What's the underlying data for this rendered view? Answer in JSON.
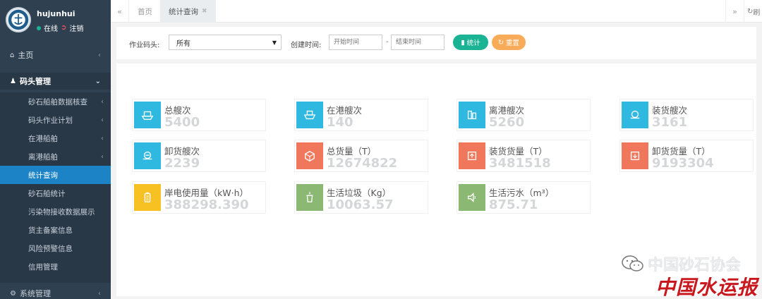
{
  "sidebar": {
    "username": "hujunhui",
    "status_online": "在线",
    "logout": "注销",
    "home": "主页",
    "dock_mgmt": "码头管理",
    "sub_items": [
      {
        "label": "砂石船舶数据核查",
        "chevron": true
      },
      {
        "label": "码头作业计划",
        "chevron": true
      },
      {
        "label": "在港船舶",
        "chevron": true
      },
      {
        "label": "离港船舶",
        "chevron": true
      },
      {
        "label": "统计查询",
        "chevron": false,
        "active": true
      },
      {
        "label": "砂石船统计",
        "chevron": false
      },
      {
        "label": "污染物接收数据展示",
        "chevron": false
      },
      {
        "label": "货主备案信息",
        "chevron": false
      },
      {
        "label": "风险预警信息",
        "chevron": false
      },
      {
        "label": "信用管理",
        "chevron": false
      }
    ],
    "system_mgmt": "系统管理"
  },
  "tabs": {
    "home": "首页",
    "stats_query": "统计查询",
    "refresh": "刷"
  },
  "filter": {
    "dock_label": "作业码头:",
    "dock_value": "所有",
    "created_label": "创建时间:",
    "start_placeholder": "开始时间",
    "end_placeholder": "结束时间",
    "separator": "-",
    "stat_button": "统计",
    "reset_button": "重置"
  },
  "cards": [
    {
      "label": "总艘次",
      "value": "5400",
      "color": "#2fb8e0",
      "icon": "ship-icon"
    },
    {
      "label": "在港艘次",
      "value": "140",
      "color": "#2fb8e0",
      "icon": "ship-in-port-icon"
    },
    {
      "label": "离港艘次",
      "value": "5260",
      "color": "#2fb8e0",
      "icon": "ship-departed-icon"
    },
    {
      "label": "装货艘次",
      "value": "3161",
      "color": "#2fb8e0",
      "icon": "loading-ship-icon"
    },
    {
      "label": "卸货艘次",
      "value": "2239",
      "color": "#2fb8e0",
      "icon": "unloading-ship-icon"
    },
    {
      "label": "总货量（T）",
      "value": "12674822",
      "color": "#f0775c",
      "icon": "cargo-box-icon"
    },
    {
      "label": "装货货量（T）",
      "value": "3481518",
      "color": "#f0775c",
      "icon": "load-cargo-icon"
    },
    {
      "label": "卸货货量（T）",
      "value": "9193304",
      "color": "#f0775c",
      "icon": "unload-cargo-icon"
    },
    {
      "label": "岸电使用量（kW·h）",
      "value": "388298.390",
      "color": "#f8c123",
      "icon": "battery-icon"
    },
    {
      "label": "生活垃圾（Kg）",
      "value": "10063.57",
      "color": "#8bb872",
      "icon": "trash-icon"
    },
    {
      "label": "生活污水（m³）",
      "value": "875.71",
      "color": "#8bb872",
      "icon": "sewage-icon"
    }
  ],
  "watermark": {
    "text": "中国砂石协会",
    "brand": "中国水运报"
  }
}
